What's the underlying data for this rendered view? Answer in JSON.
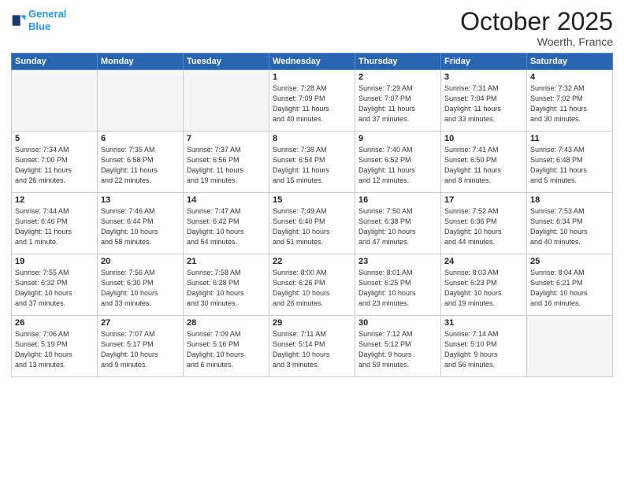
{
  "header": {
    "logo_line1": "General",
    "logo_line2": "Blue",
    "month": "October 2025",
    "location": "Woerth, France"
  },
  "days_of_week": [
    "Sunday",
    "Monday",
    "Tuesday",
    "Wednesday",
    "Thursday",
    "Friday",
    "Saturday"
  ],
  "weeks": [
    [
      {
        "day": "",
        "info": "",
        "empty": true
      },
      {
        "day": "",
        "info": "",
        "empty": true
      },
      {
        "day": "",
        "info": "",
        "empty": true
      },
      {
        "day": "1",
        "info": "Sunrise: 7:28 AM\nSunset: 7:09 PM\nDaylight: 11 hours\nand 40 minutes."
      },
      {
        "day": "2",
        "info": "Sunrise: 7:29 AM\nSunset: 7:07 PM\nDaylight: 11 hours\nand 37 minutes."
      },
      {
        "day": "3",
        "info": "Sunrise: 7:31 AM\nSunset: 7:04 PM\nDaylight: 11 hours\nand 33 minutes."
      },
      {
        "day": "4",
        "info": "Sunrise: 7:32 AM\nSunset: 7:02 PM\nDaylight: 11 hours\nand 30 minutes."
      }
    ],
    [
      {
        "day": "5",
        "info": "Sunrise: 7:34 AM\nSunset: 7:00 PM\nDaylight: 11 hours\nand 26 minutes."
      },
      {
        "day": "6",
        "info": "Sunrise: 7:35 AM\nSunset: 6:58 PM\nDaylight: 11 hours\nand 22 minutes."
      },
      {
        "day": "7",
        "info": "Sunrise: 7:37 AM\nSunset: 6:56 PM\nDaylight: 11 hours\nand 19 minutes."
      },
      {
        "day": "8",
        "info": "Sunrise: 7:38 AM\nSunset: 6:54 PM\nDaylight: 11 hours\nand 15 minutes."
      },
      {
        "day": "9",
        "info": "Sunrise: 7:40 AM\nSunset: 6:52 PM\nDaylight: 11 hours\nand 12 minutes."
      },
      {
        "day": "10",
        "info": "Sunrise: 7:41 AM\nSunset: 6:50 PM\nDaylight: 11 hours\nand 8 minutes."
      },
      {
        "day": "11",
        "info": "Sunrise: 7:43 AM\nSunset: 6:48 PM\nDaylight: 11 hours\nand 5 minutes."
      }
    ],
    [
      {
        "day": "12",
        "info": "Sunrise: 7:44 AM\nSunset: 6:46 PM\nDaylight: 11 hours\nand 1 minute."
      },
      {
        "day": "13",
        "info": "Sunrise: 7:46 AM\nSunset: 6:44 PM\nDaylight: 10 hours\nand 58 minutes."
      },
      {
        "day": "14",
        "info": "Sunrise: 7:47 AM\nSunset: 6:42 PM\nDaylight: 10 hours\nand 54 minutes."
      },
      {
        "day": "15",
        "info": "Sunrise: 7:49 AM\nSunset: 6:40 PM\nDaylight: 10 hours\nand 51 minutes."
      },
      {
        "day": "16",
        "info": "Sunrise: 7:50 AM\nSunset: 6:38 PM\nDaylight: 10 hours\nand 47 minutes."
      },
      {
        "day": "17",
        "info": "Sunrise: 7:52 AM\nSunset: 6:36 PM\nDaylight: 10 hours\nand 44 minutes."
      },
      {
        "day": "18",
        "info": "Sunrise: 7:53 AM\nSunset: 6:34 PM\nDaylight: 10 hours\nand 40 minutes."
      }
    ],
    [
      {
        "day": "19",
        "info": "Sunrise: 7:55 AM\nSunset: 6:32 PM\nDaylight: 10 hours\nand 37 minutes."
      },
      {
        "day": "20",
        "info": "Sunrise: 7:56 AM\nSunset: 6:30 PM\nDaylight: 10 hours\nand 33 minutes."
      },
      {
        "day": "21",
        "info": "Sunrise: 7:58 AM\nSunset: 6:28 PM\nDaylight: 10 hours\nand 30 minutes."
      },
      {
        "day": "22",
        "info": "Sunrise: 8:00 AM\nSunset: 6:26 PM\nDaylight: 10 hours\nand 26 minutes."
      },
      {
        "day": "23",
        "info": "Sunrise: 8:01 AM\nSunset: 6:25 PM\nDaylight: 10 hours\nand 23 minutes."
      },
      {
        "day": "24",
        "info": "Sunrise: 8:03 AM\nSunset: 6:23 PM\nDaylight: 10 hours\nand 19 minutes."
      },
      {
        "day": "25",
        "info": "Sunrise: 8:04 AM\nSunset: 6:21 PM\nDaylight: 10 hours\nand 16 minutes."
      }
    ],
    [
      {
        "day": "26",
        "info": "Sunrise: 7:06 AM\nSunset: 5:19 PM\nDaylight: 10 hours\nand 13 minutes."
      },
      {
        "day": "27",
        "info": "Sunrise: 7:07 AM\nSunset: 5:17 PM\nDaylight: 10 hours\nand 9 minutes."
      },
      {
        "day": "28",
        "info": "Sunrise: 7:09 AM\nSunset: 5:16 PM\nDaylight: 10 hours\nand 6 minutes."
      },
      {
        "day": "29",
        "info": "Sunrise: 7:11 AM\nSunset: 5:14 PM\nDaylight: 10 hours\nand 3 minutes."
      },
      {
        "day": "30",
        "info": "Sunrise: 7:12 AM\nSunset: 5:12 PM\nDaylight: 9 hours\nand 59 minutes."
      },
      {
        "day": "31",
        "info": "Sunrise: 7:14 AM\nSunset: 5:10 PM\nDaylight: 9 hours\nand 56 minutes."
      },
      {
        "day": "",
        "info": "",
        "empty": true
      }
    ]
  ]
}
